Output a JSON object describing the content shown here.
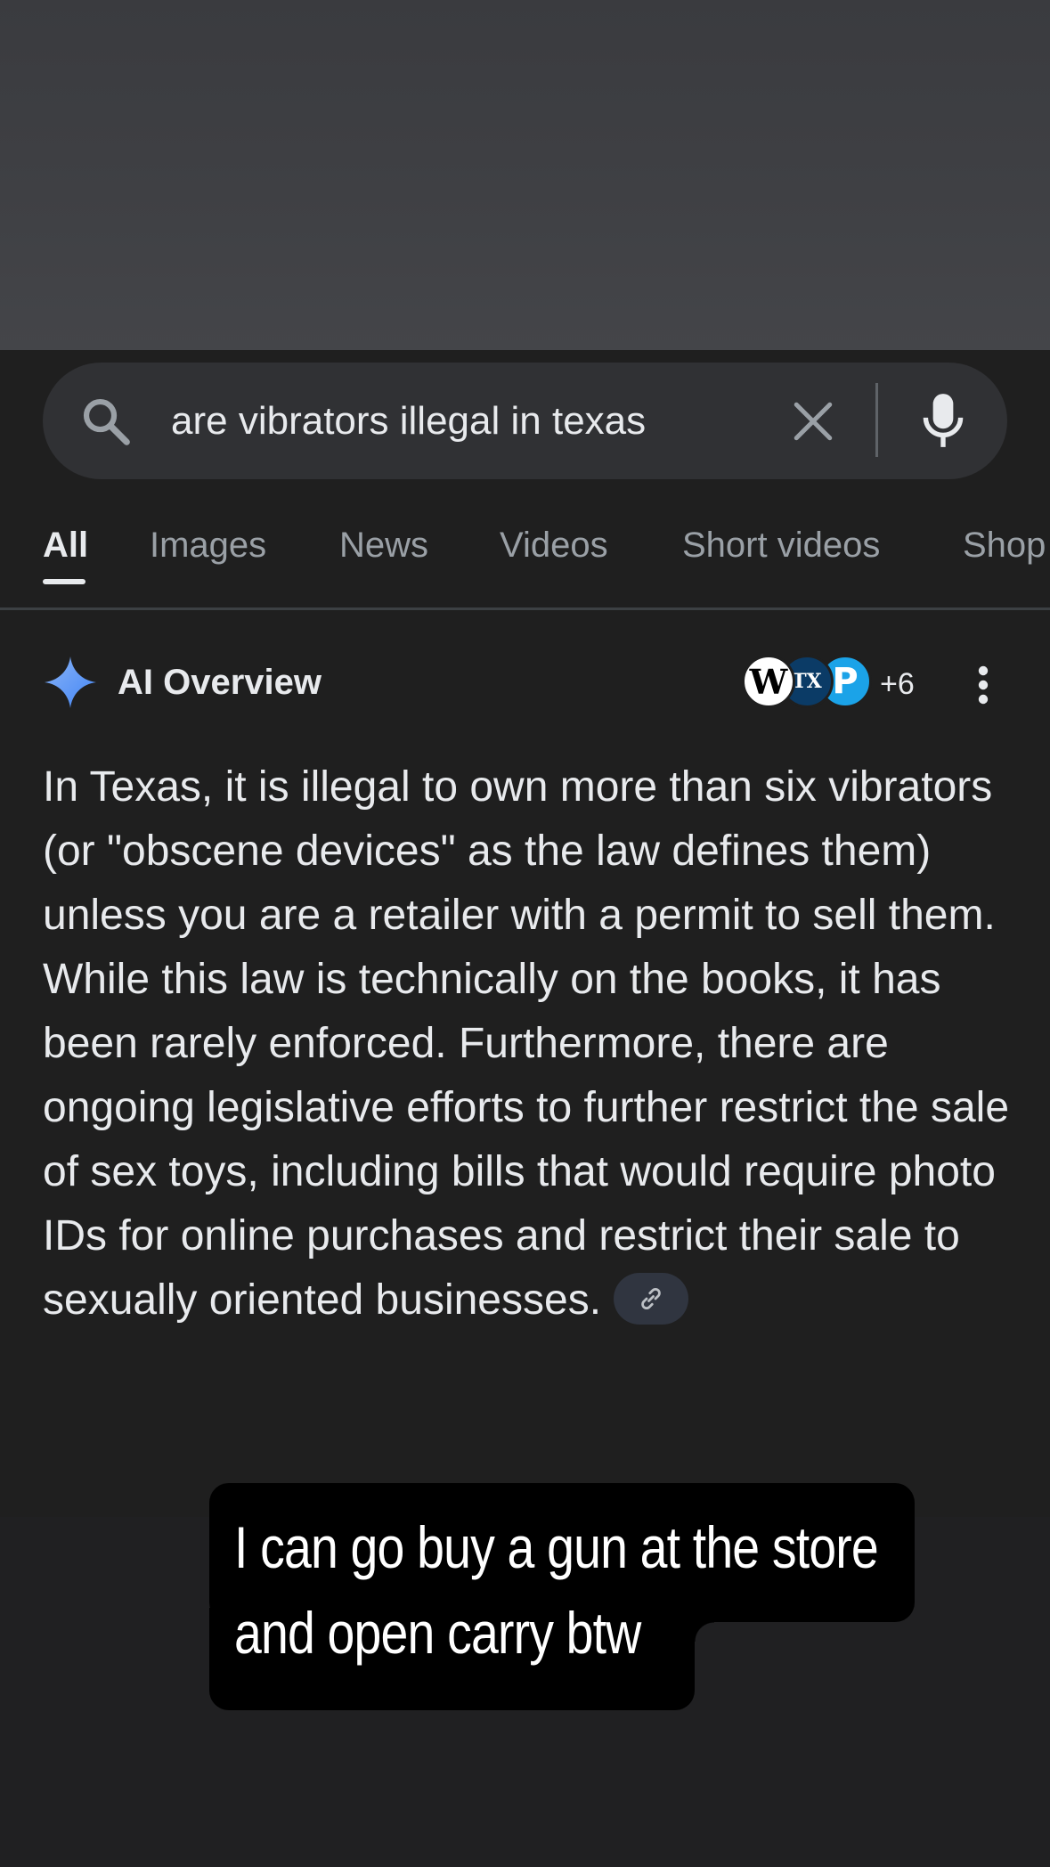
{
  "search": {
    "query": "are vibrators illegal in texas"
  },
  "tabs": [
    {
      "label": "All",
      "active": true
    },
    {
      "label": "Images",
      "active": false
    },
    {
      "label": "News",
      "active": false
    },
    {
      "label": "Videos",
      "active": false
    },
    {
      "label": "Short videos",
      "active": false
    },
    {
      "label": "Shop",
      "active": false
    }
  ],
  "ai_overview": {
    "title": "AI Overview",
    "source_count": "+6",
    "sources": [
      "W",
      "TX",
      "P"
    ],
    "body": "In Texas, it is illegal to own more than six vibrators (or \"obscene devices\" as the law defines them) unless you are a retailer with a permit to sell them. While this law is technically on the books, it has been rarely enforced. Furthermore, there are ongoing legislative efforts to further restrict the sale of sex toys, including bills that would require photo IDs for online purchases and restrict their sale to sexually oriented businesses."
  },
  "caption": {
    "line1": "I can go buy a gun at the store",
    "line2": "and open carry btw"
  },
  "icons": {
    "search": "search-icon",
    "clear": "close-icon",
    "mic": "microphone-icon",
    "spark": "gemini-sparkle-icon",
    "more": "more-vertical-icon",
    "link": "link-icon"
  },
  "colors": {
    "accent_blue": "#4285f4",
    "text": "#e8eaed",
    "muted": "#9aa0a6"
  }
}
